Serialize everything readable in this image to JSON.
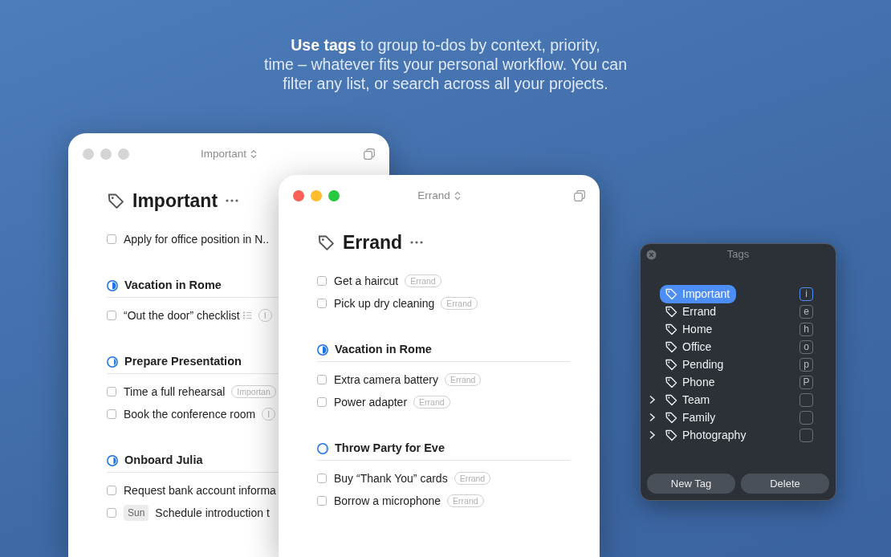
{
  "intro_lines": [
    "**Use tags** to group to-dos by context, priority,",
    "time – whatever fits your personal workflow. You can",
    "filter any list, or search across all your projects."
  ],
  "windows": [
    {
      "active": false,
      "title": "Important",
      "heading": "Important",
      "blocks": [
        {
          "kind": "todo",
          "text": "Apply for office position in N..",
          "checked": false,
          "checklist": false
        },
        {
          "kind": "project",
          "title": "Vacation in Rome",
          "level": 0.5,
          "todos": [
            {
              "text": "“Out the door” checklist",
              "checked": false,
              "checklist": true,
              "tag": "I"
            }
          ]
        },
        {
          "kind": "project",
          "title": "Prepare Presentation",
          "level": 0.35,
          "todos": [
            {
              "text": "Time a full rehearsal",
              "checked": false,
              "checklist": false,
              "tag": "Importan"
            },
            {
              "text": "Book the conference room",
              "checked": false,
              "checklist": false,
              "tag": "I"
            }
          ]
        },
        {
          "kind": "project",
          "title": "Onboard Julia",
          "level": 0.4,
          "todos": [
            {
              "text": "Request bank account informa",
              "checked": false,
              "checklist": false
            },
            {
              "text": "Schedule introduction t",
              "checked": false,
              "checklist": false,
              "when": "Sun"
            }
          ]
        }
      ]
    },
    {
      "active": true,
      "title": "Errand",
      "heading": "Errand",
      "blocks": [
        {
          "kind": "todo",
          "text": "Get a haircut",
          "checked": false,
          "checklist": false,
          "tag": "Errand"
        },
        {
          "kind": "todo",
          "text": "Pick up dry cleaning",
          "checked": false,
          "checklist": false,
          "tag": "Errand"
        },
        {
          "kind": "project",
          "title": "Vacation in Rome",
          "level": 0.5,
          "todos": [
            {
              "text": "Extra camera battery",
              "checked": false,
              "checklist": false,
              "tag": "Errand"
            },
            {
              "text": "Power adapter",
              "checked": false,
              "checklist": false,
              "tag": "Errand"
            }
          ]
        },
        {
          "kind": "project",
          "title": "Throw Party for Eve",
          "level": 0.2,
          "todos": [
            {
              "text": "Buy “Thank You” cards",
              "checked": false,
              "checklist": false,
              "tag": "Errand"
            },
            {
              "text": "Borrow a microphone",
              "checked": false,
              "checklist": false,
              "tag": "Errand"
            }
          ]
        }
      ]
    }
  ],
  "tags_panel": {
    "title": "Tags",
    "items": [
      {
        "label": "Important",
        "shortcut": "i",
        "selected": true,
        "expandable": false
      },
      {
        "label": "Errand",
        "shortcut": "e",
        "selected": false,
        "expandable": false
      },
      {
        "label": "Home",
        "shortcut": "h",
        "selected": false,
        "expandable": false
      },
      {
        "label": "Office",
        "shortcut": "o",
        "selected": false,
        "expandable": false
      },
      {
        "label": "Pending",
        "shortcut": "p",
        "selected": false,
        "expandable": false
      },
      {
        "label": "Phone",
        "shortcut": "P",
        "selected": false,
        "expandable": false
      },
      {
        "label": "Team",
        "selected": false,
        "expandable": true
      },
      {
        "label": "Family",
        "selected": false,
        "expandable": true
      },
      {
        "label": "Photography",
        "selected": false,
        "expandable": true
      }
    ],
    "buttons": [
      "New Tag",
      "Delete"
    ]
  }
}
